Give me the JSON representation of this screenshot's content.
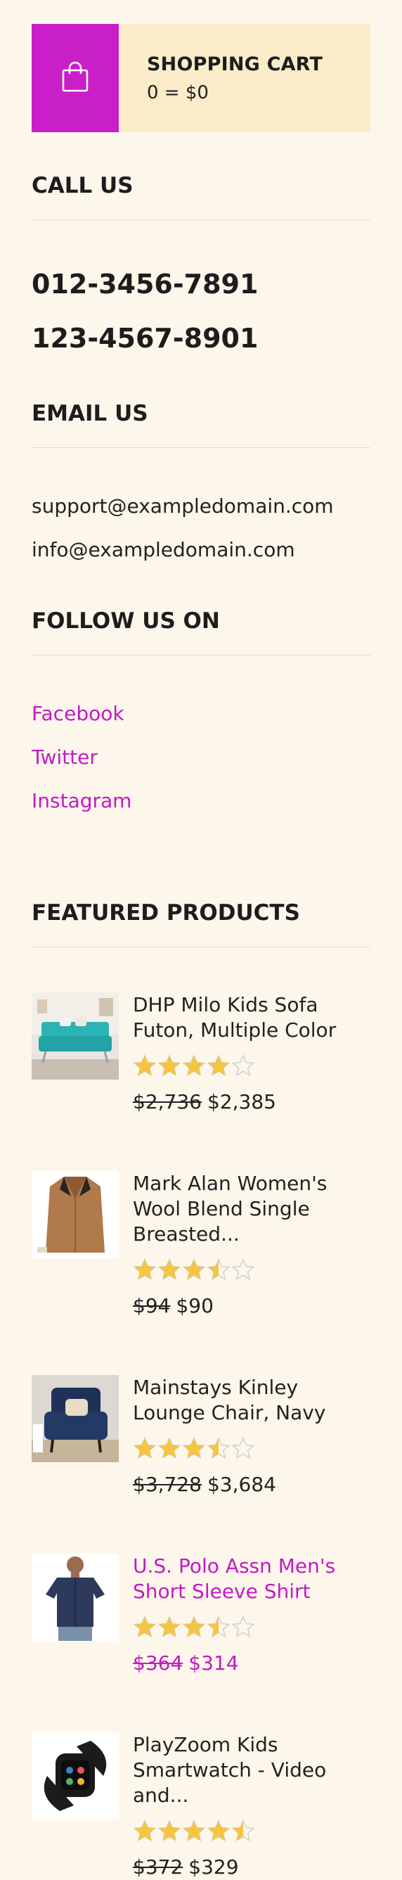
{
  "cart": {
    "icon": "shopping-bag-icon",
    "title": "SHOPPING CART",
    "total": "0 = $0",
    "accent_color": "#c91fc9",
    "bg_color": "#faecc9"
  },
  "call": {
    "title": "CALL US",
    "phones": [
      "012-3456-7891",
      "123-4567-8901"
    ]
  },
  "email": {
    "title": "EMAIL US",
    "addresses": [
      "support@exampledomain.com",
      "info@exampledomain.com"
    ]
  },
  "follow": {
    "title": "FOLLOW US ON",
    "links": [
      "Facebook",
      "Twitter",
      "Instagram"
    ],
    "link_color": "#c11bc6"
  },
  "featured": {
    "title": "FEATURED PRODUCTS",
    "star_color": "#f5c542",
    "products": [
      {
        "name": "DHP Milo Kids Sofa Futon, Multiple Color",
        "rating": 4,
        "old_price": "$2,736",
        "price": "$2,385",
        "image": "teal-futon-image"
      },
      {
        "name": "Mark Alan Women's Wool Blend Single Breasted...",
        "rating": 3.5,
        "old_price": "$94",
        "price": "$90",
        "image": "brown-coat-image"
      },
      {
        "name": "Mainstays Kinley Lounge Chair, Navy",
        "rating": 3.5,
        "old_price": "$3,728",
        "price": "$3,684",
        "image": "navy-chair-image"
      },
      {
        "name": "U.S. Polo Assn Men's Short Sleeve Shirt",
        "rating": 3.5,
        "old_price": "$364",
        "price": "$314",
        "image": "navy-shirt-image"
      },
      {
        "name": "PlayZoom Kids Smartwatch - Video and...",
        "rating": 4.5,
        "old_price": "$372",
        "price": "$329",
        "image": "black-smartwatch-image"
      }
    ]
  }
}
